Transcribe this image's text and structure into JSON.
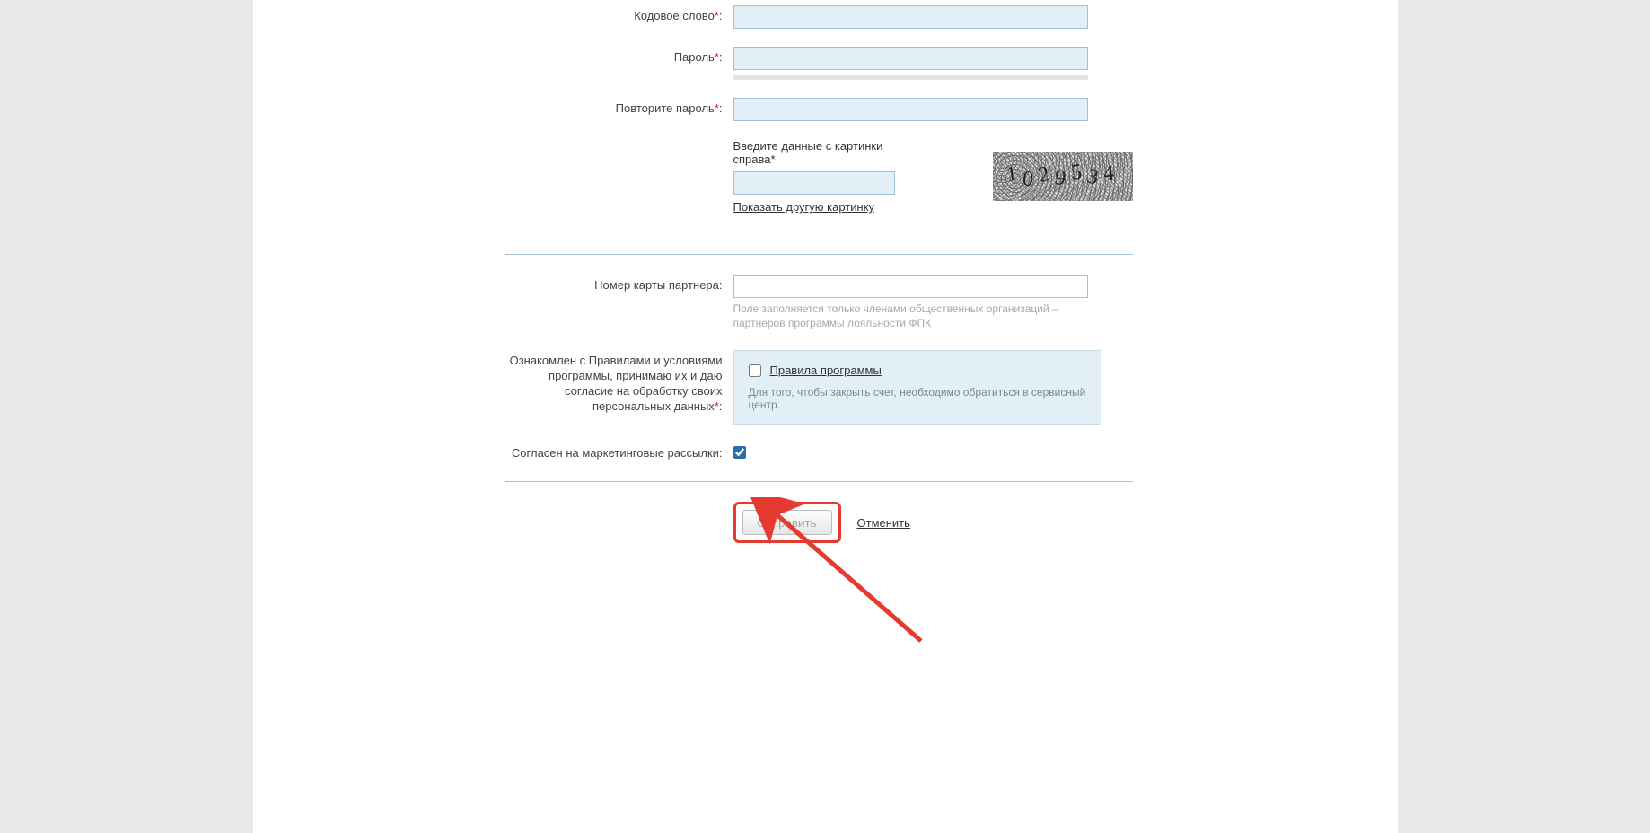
{
  "fields": {
    "codeword_label": "Кодовое слово",
    "password_label": "Пароль",
    "password_repeat_label": "Повторите пароль",
    "captcha_title": "Введите данные с картинки справа",
    "captcha_refresh": "Показать другую картинку",
    "captcha_value": "1029534",
    "partner_card_label": "Номер карты партнера:",
    "partner_card_hint": "Поле заполняется только членами общественных организаций – партнеров программы лояльности ФПК",
    "consent_label": "Ознакомлен с Правилами и условиями программы, принимаю их и даю согласие на обработку своих персональных данных",
    "consent_link": "Правила программы",
    "consent_note": "Для того, чтобы закрыть счет, необходимо обратиться в сервисный центр.",
    "marketing_label": "Согласен на маркетинговые рассылки:",
    "submit": "Отправить",
    "cancel": "Отменить",
    "colon": ":",
    "asterisk": "*"
  }
}
